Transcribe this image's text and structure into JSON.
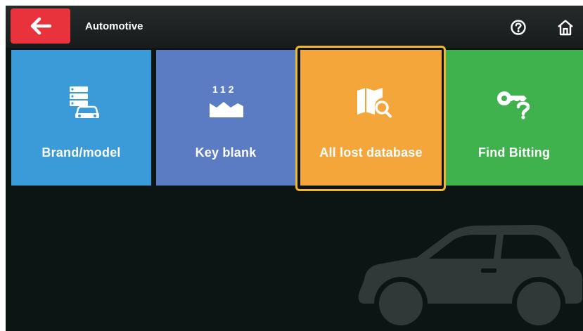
{
  "header": {
    "back_icon": "arrow-left-icon",
    "title": "Automotive",
    "help_icon": "help-circle-icon",
    "home_icon": "home-icon"
  },
  "tiles": [
    {
      "label": "Brand/model",
      "icon": "car-database-icon",
      "color": "#3b9bd9"
    },
    {
      "label": "Key blank",
      "icon": "key-blank-icon",
      "icon_text": "112",
      "color": "#5b7cc2"
    },
    {
      "label": "All lost database",
      "icon": "map-search-icon",
      "color": "#f4a63a",
      "selected": true
    },
    {
      "label": "Find Bitting",
      "icon": "key-question-icon",
      "color": "#3fb14d"
    }
  ],
  "colors": {
    "accent_red": "#e8333d",
    "background": "#0c1414",
    "selection_border": "#f2b62b",
    "car_silhouette": "#303838"
  },
  "decoration": {
    "background_icon": "car-silhouette-icon"
  }
}
